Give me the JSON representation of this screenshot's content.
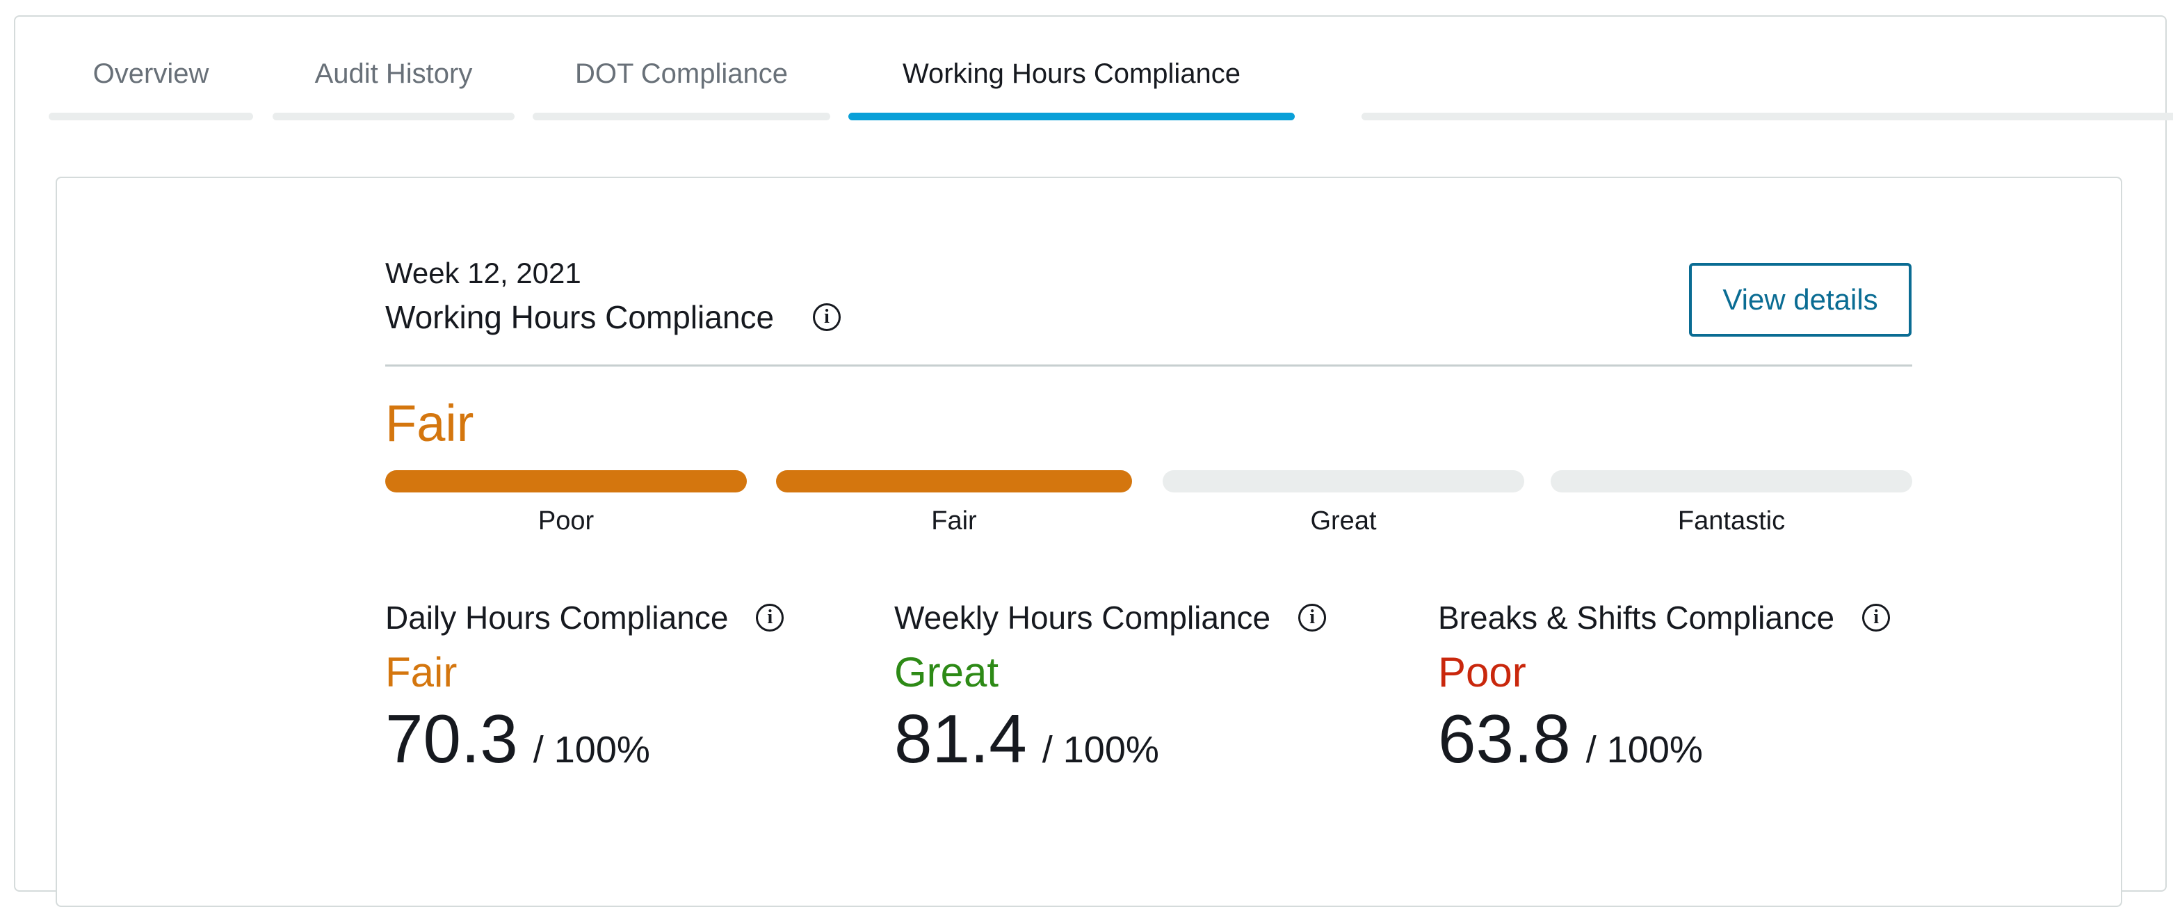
{
  "tabs": [
    {
      "label": "Overview"
    },
    {
      "label": "Audit History"
    },
    {
      "label": "DOT Compliance"
    },
    {
      "label": "Working Hours Compliance"
    }
  ],
  "active_tab_index": 3,
  "panel": {
    "week": "Week 12, 2021",
    "title": "Working Hours Compliance",
    "view_details_label": "View details",
    "overall_rating": "Fair",
    "scale": {
      "levels": [
        "Poor",
        "Fair",
        "Great",
        "Fantastic"
      ],
      "filled_count": 2
    },
    "metrics": [
      {
        "name": "Daily Hours Compliance",
        "rating": "Fair",
        "score": "70.3",
        "max": "/ 100%"
      },
      {
        "name": "Weekly Hours Compliance",
        "rating": "Great",
        "score": "81.4",
        "max": "/ 100%"
      },
      {
        "name": "Breaks & Shifts Compliance",
        "rating": "Poor",
        "score": "63.8",
        "max": "/ 100%"
      }
    ],
    "info_icon_glyph": "i"
  },
  "colors": {
    "active_tab": "#0aa0d8",
    "fair": "#d4760e",
    "great": "#2d8a16",
    "poor": "#c9270c",
    "button": "#0a6c93"
  }
}
